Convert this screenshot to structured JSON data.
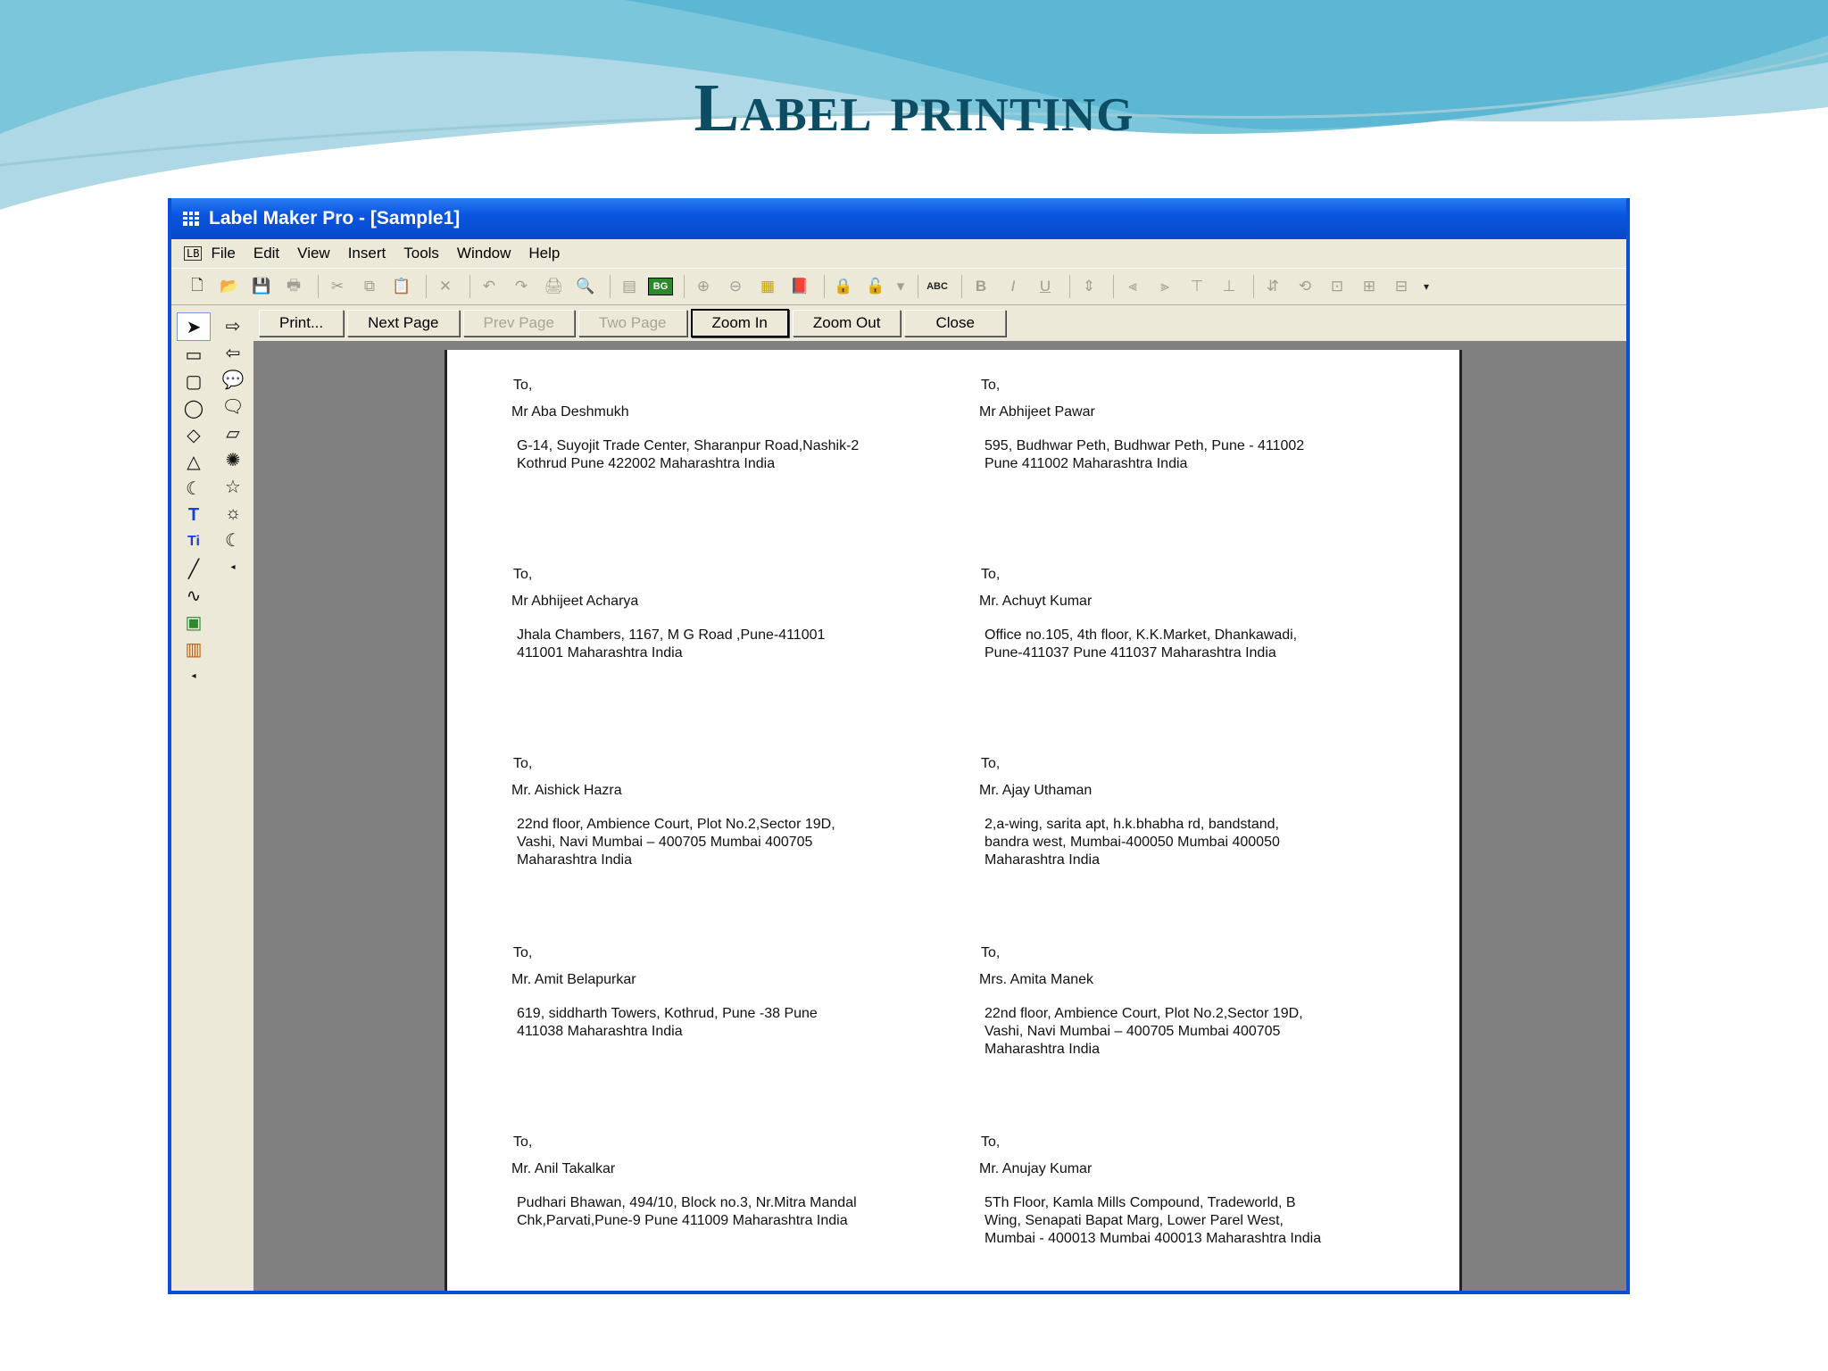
{
  "slide": {
    "title": "Label printing"
  },
  "window": {
    "title": "Label Maker Pro - [Sample1]"
  },
  "menu": {
    "doc_badge": "LB",
    "items": [
      "File",
      "Edit",
      "View",
      "Insert",
      "Tools",
      "Window",
      "Help"
    ]
  },
  "preview_buttons": [
    "Print...",
    "Next Page",
    "Prev Page",
    "Two Page",
    "Zoom In",
    "Zoom Out",
    "Close"
  ],
  "labels": [
    {
      "to": "To,",
      "name": "Mr Aba  Deshmukh",
      "address": "G-14,  Suyojit  Trade  Center,  Sharanpur  Road,Nashik-2\nKothrud  Pune  422002  Maharashtra  India"
    },
    {
      "to": "To,",
      "name": "Mr Abhijeet   Pawar",
      "address": "595,  Budhwar  Peth,  Budhwar  Peth,  Pune - 411002\nPune  411002  Maharashtra  India"
    },
    {
      "to": "To,",
      "name": "Mr Abhijeet   Acharya",
      "address": "Jhala  Chambers, 1167,  M G Road  ,Pune-411001\n411001  Maharashtra  India"
    },
    {
      "to": "To,",
      "name": "Mr. Achuyt   Kumar",
      "address": "Office  no.105,  4th floor,  K.K.Market,  Dhankawadi,\nPune-411037    Pune  411037  Maharashtra  India"
    },
    {
      "to": "To,",
      "name": "Mr. Aishick    Hazra",
      "address": "22nd  floor,  Ambience  Court,  Plot  No.2,Sector  19D,\nVashi,  Navi  Mumbai – 400705   Mumbai  400705\nMaharashtra  India"
    },
    {
      "to": "To,",
      "name": "Mr. Ajay    Uthaman",
      "address": "2,a-wing,  sarita  apt,  h.k.bhabha  rd,  bandstand,\nbandra  west,  Mumbai-400050    Mumbai  400050\nMaharashtra  India"
    },
    {
      "to": "To,",
      "name": "Mr. Amit    Belapurkar",
      "address": "619,  siddharth  Towers,  Kothrud,  Pune  -38    Pune\n411038  Maharashtra  India"
    },
    {
      "to": "To,",
      "name": "Mrs. Amita   Manek",
      "address": "22nd  floor,  Ambience  Court,  Plot  No.2,Sector  19D,\nVashi,  Navi  Mumbai – 400705   Mumbai  400705\nMaharashtra  India"
    },
    {
      "to": "To,",
      "name": "Mr. Anil    Takalkar",
      "address": "Pudhari  Bhawan,  494/10,  Block  no.3,  Nr.Mitra  Mandal\nChk,Parvati,Pune-9    Pune  411009  Maharashtra  India"
    },
    {
      "to": "To,",
      "name": "Mr. Anujay    Kumar",
      "address": "5Th  Floor,  Kamla  Mills  Compound,  Tradeworld,  B\nWing,  Senapati  Bapat  Marg,  Lower  Parel  West,\nMumbai  -  400013    Mumbai  400013  Maharashtra  India"
    }
  ],
  "colors": {
    "title_text": "#0d4d63",
    "titlebar": "#0a56e0",
    "workspace": "#808080",
    "chrome": "#ece9d8"
  }
}
